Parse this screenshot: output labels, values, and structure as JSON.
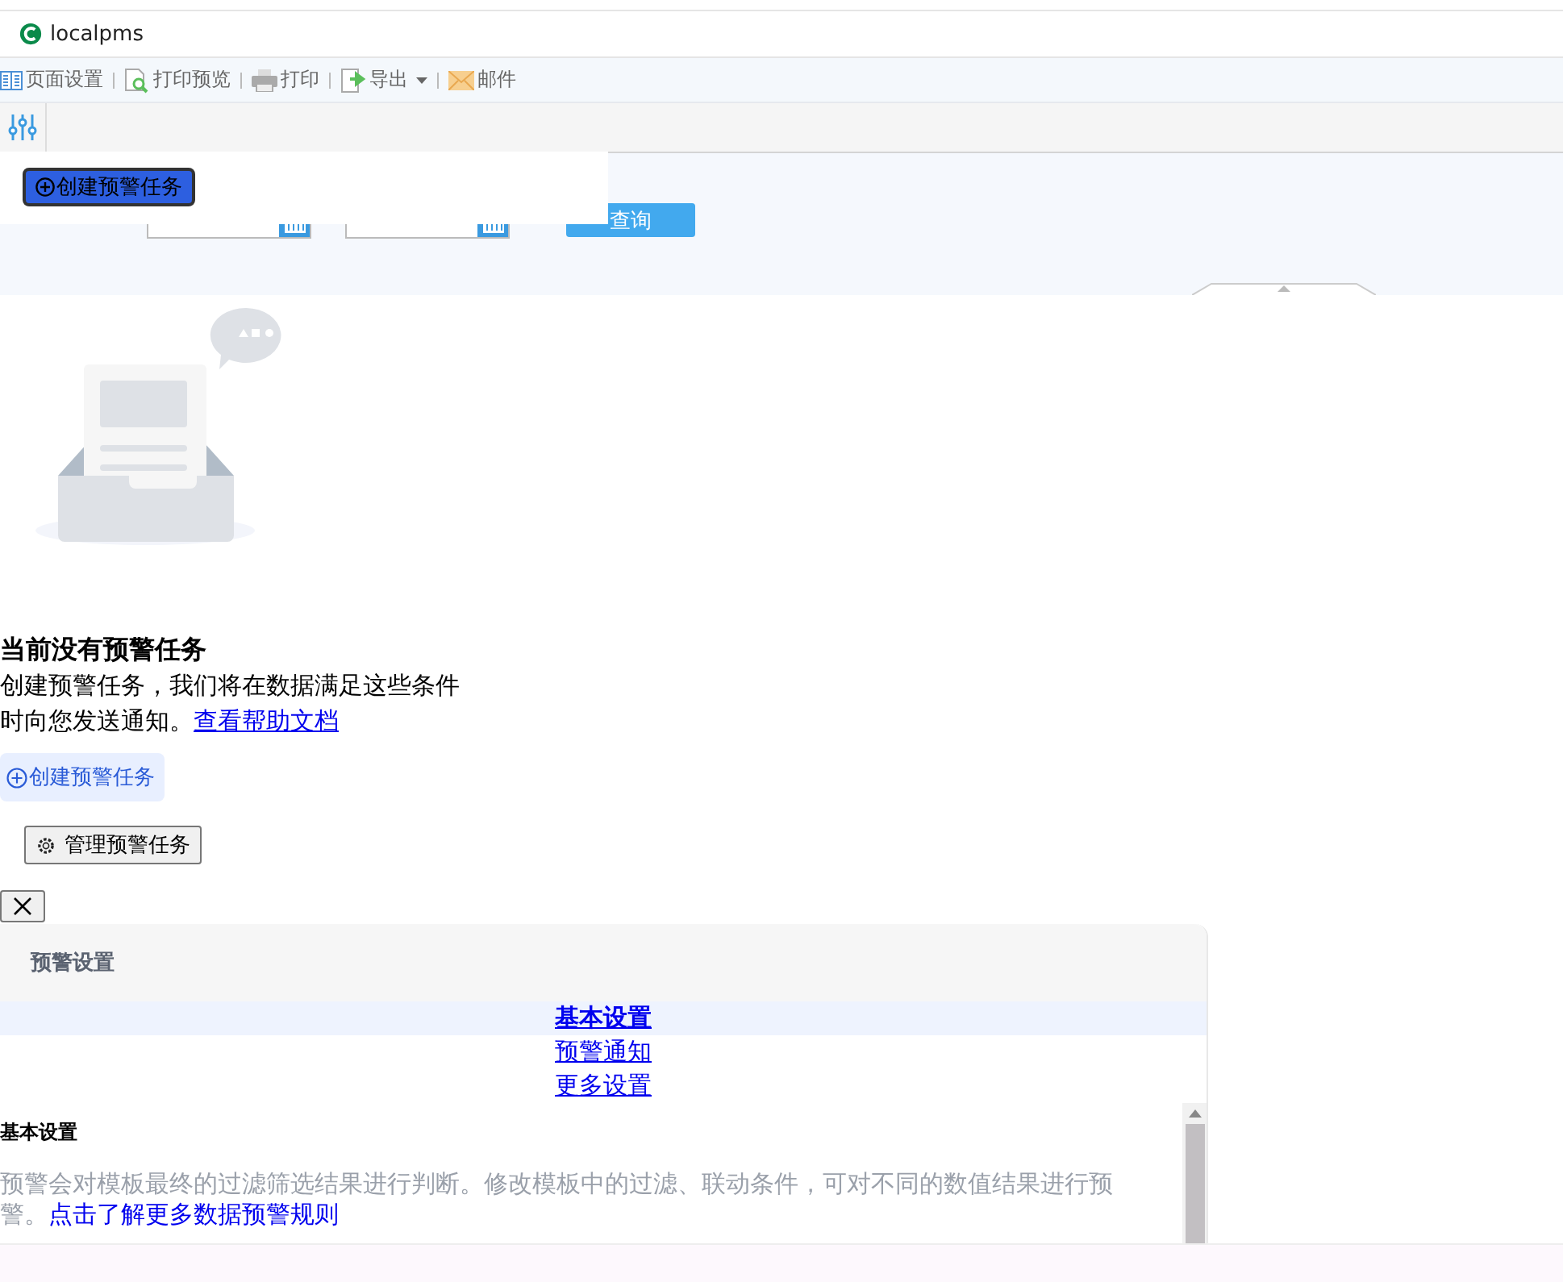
{
  "window": {
    "title": "localpms"
  },
  "toolbar": [
    {
      "kind": "page",
      "label": "页面设置",
      "dropdown": false
    },
    {
      "kind": "preview",
      "label": "打印预览",
      "dropdown": false
    },
    {
      "kind": "print",
      "label": "打印",
      "dropdown": false
    },
    {
      "kind": "export",
      "label": "导出",
      "dropdown": true
    },
    {
      "kind": "mail",
      "label": "邮件",
      "dropdown": false
    }
  ],
  "filter": {
    "query_button": "查询"
  },
  "overlay": {
    "create_button": "创建预警任务"
  },
  "empty_state": {
    "heading": "当前没有预警任务",
    "text": "创建预警任务，我们将在数据满足这些条件时向您发送通知。",
    "help_link": "查看帮助文档",
    "create_button": "创建预警任务",
    "manage_button": "管理预警任务"
  },
  "dialog": {
    "title": "预警设置",
    "tabs": [
      {
        "label": "基本设置",
        "selected": true
      },
      {
        "label": "预警通知",
        "selected": false
      },
      {
        "label": "更多设置",
        "selected": false
      }
    ],
    "section_title": "基本设置",
    "description": "预警会对模板最终的过滤筛选结果进行判断。修改模板中的过滤、联动条件，可对不同的数值结果进行预警。",
    "rules_link": "点击了解更多数据预警规则"
  }
}
